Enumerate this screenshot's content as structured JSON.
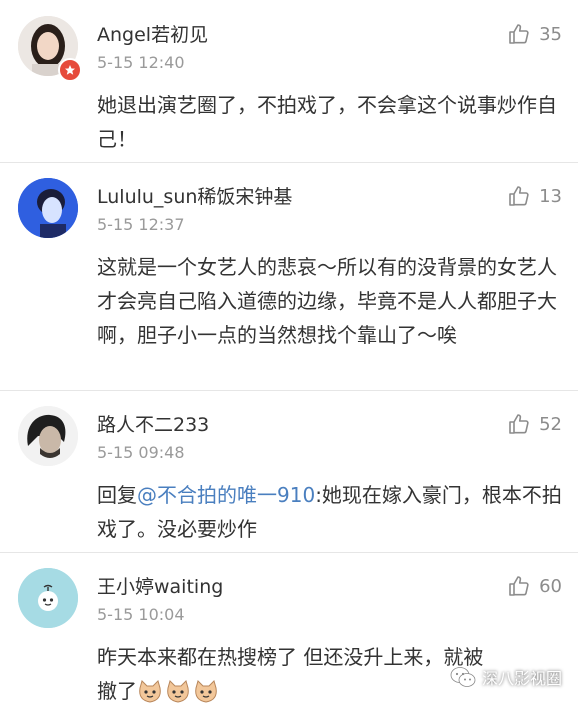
{
  "comments": [
    {
      "username": "Angel若初见",
      "time": "5-15 12:40",
      "likes": "35",
      "text": "她退出演艺圈了，不拍戏了，不会拿这个说事炒作自己！"
    },
    {
      "username": "Lululu_sun稀饭宋钟基",
      "time": "5-15 12:37",
      "likes": "13",
      "text": "这就是一个女艺人的悲哀～所以有的没背景的女艺人才会亮自己陷入道德的边缘，毕竟不是人人都胆子大啊，胆子小一点的当然想找个靠山了～唉"
    },
    {
      "username": "路人不二233",
      "time": "5-15 09:48",
      "likes": "52",
      "reply_prefix": "回复",
      "mention": "@不合拍的唯一910",
      "text": ":她现在嫁入豪门，根本不拍戏了。没必要炒作"
    },
    {
      "username": "王小婷waiting",
      "time": "5-15 10:04",
      "likes": "60",
      "text": "昨天本来都在热搜榜了 但还没升上来，就被撤了"
    }
  ],
  "watermark": {
    "label": "深八影视圈"
  },
  "colors": {
    "mention": "#4a7fbf",
    "time": "#9a9a9a",
    "divider": "#e6e6e6"
  }
}
